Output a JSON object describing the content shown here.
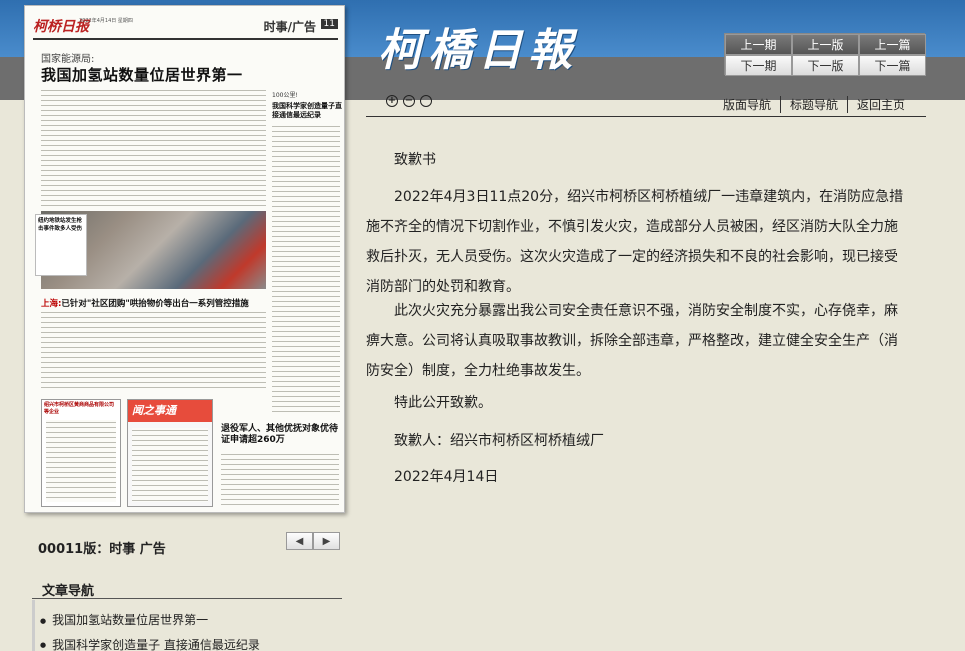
{
  "header": {
    "logo_text": "柯橋日報",
    "nav_buttons": {
      "prev_issue": "上一期",
      "prev_edition": "上一版",
      "prev_article": "上一篇",
      "next_issue": "下一期",
      "next_edition": "下一版",
      "next_article": "下一篇"
    }
  },
  "paper": {
    "masthead": "柯桥日报",
    "meta": "2022年4月14日 星期四",
    "section": "时事/广告",
    "page_num": "11",
    "kicker": "国家能源局:",
    "headline": "我国加氢站数量位居世界第一",
    "right_kicker": "100公里!",
    "right_headline": "我国科学家创造量子直接通信最远纪录",
    "photo_caption": "纽约地铁站发生枪击事件致多人受伤",
    "sub_red": "上海:",
    "sub_black": "已针对\"社区团购\"哄抬物价等出台一系列管控措施",
    "ad_left": "绍兴市柯桥区黄商商品有限公司等企业",
    "ad_mid": "闻之事通",
    "ad_headline": "退役军人、其他优抚对象优待证申请超260万"
  },
  "below_paper": {
    "edition_label": "00011版：时事 广告",
    "prev_page": "◀",
    "next_page": "▶"
  },
  "article_nav": {
    "title": "文章导航",
    "items": [
      "我国加氢站数量位居世界第一",
      "我国科学家创造量子 直接通信最远纪录"
    ]
  },
  "toolbar": {
    "zoom_in": "+",
    "zoom_out": "−",
    "zoom_reset": "",
    "links": [
      "版面导航",
      "标题导航",
      "返回主页"
    ]
  },
  "article": {
    "title": "致歉书",
    "para1": "2022年4月3日11点20分，绍兴市柯桥区柯桥植绒厂一违章建筑内，在消防应急措施不齐全的情况下切割作业，不慎引发火灾，造成部分人员被困，经区消防大队全力施救后扑灭，无人员受伤。这次火灾造成了一定的经济损失和不良的社会影响，现已接受消防部门的处罚和教育。",
    "para2": "此次火灾充分暴露出我公司安全责任意识不强，消防安全制度不实，心存侥幸，麻痹大意。公司将认真吸取事故教训，拆除全部违章，严格整改，建立健全安全生产（消防安全）制度，全力杜绝事故发生。",
    "para3": "特此公开致歉。",
    "signature": "致歉人：绍兴市柯桥区柯桥植绒厂",
    "date": "2022年4月14日"
  }
}
